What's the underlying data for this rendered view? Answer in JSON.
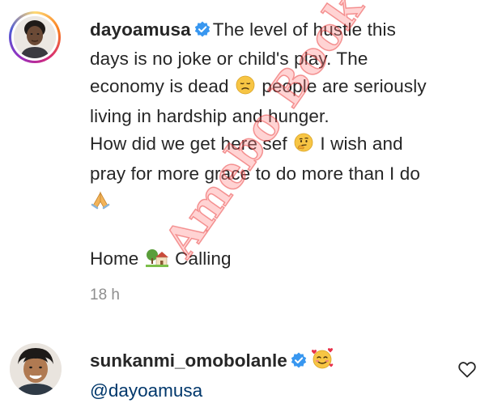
{
  "post": {
    "username": "dayoamusa",
    "lines": [
      "The level of hustle this",
      "days is no joke or child's play. The",
      "economy is dead",
      "people are seriously",
      "living in hardship and hunger.",
      "How did we get here sef",
      "I wish and",
      "pray for more grace to do more than I do",
      "Home",
      "Calling"
    ],
    "timestamp": "18 h",
    "icons": [
      "verified-badge-icon",
      "disappointed-face-emoji",
      "thinking-face-emoji",
      "folded-hands-emoji",
      "house-with-garden-emoji"
    ]
  },
  "reply": {
    "username": "sunkanmi_omobolanle",
    "mention": "@dayoamusa",
    "icons": [
      "verified-badge-icon",
      "smiling-face-with-hearts-emoji",
      "heart-outline-icon"
    ]
  },
  "watermark": "Amebo Book",
  "colors": {
    "text": "#262626",
    "muted": "#8e8e8e",
    "mention": "#00376b",
    "verified": "#3897f0",
    "watermark": "#e62828"
  }
}
